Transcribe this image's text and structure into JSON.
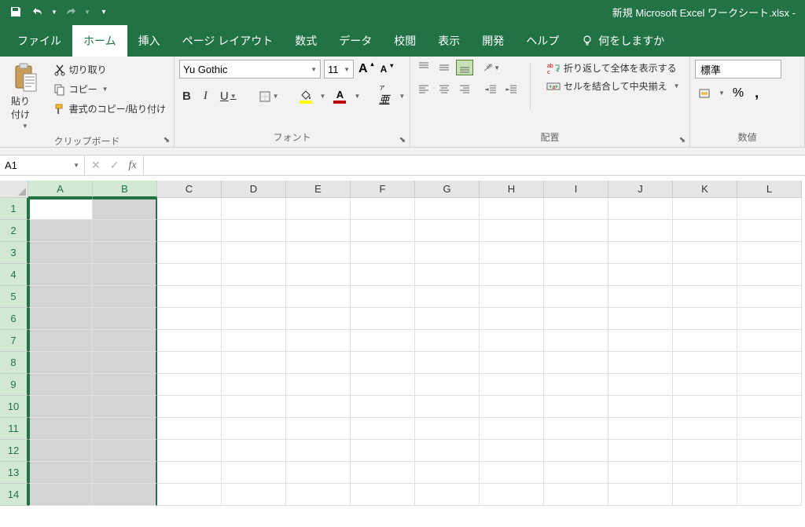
{
  "title": "新規 Microsoft Excel ワークシート.xlsx  -",
  "tabs": {
    "file": "ファイル",
    "home": "ホーム",
    "insert": "挿入",
    "page_layout": "ページ レイアウト",
    "formulas": "数式",
    "data": "データ",
    "review": "校閲",
    "view": "表示",
    "developer": "開発",
    "help": "ヘルプ",
    "tell_me": "何をしますか"
  },
  "clipboard": {
    "paste": "貼り付け",
    "cut": "切り取り",
    "copy": "コピー",
    "format_painter": "書式のコピー/貼り付け",
    "group": "クリップボード"
  },
  "font": {
    "name": "Yu Gothic",
    "size": "11",
    "group": "フォント"
  },
  "alignment": {
    "wrap": "折り返して全体を表示する",
    "merge": "セルを結合して中央揃え",
    "group": "配置"
  },
  "number": {
    "format": "標準",
    "percent": "%",
    "comma": ",",
    "group": "数値"
  },
  "namebox": "A1",
  "columns": [
    "A",
    "B",
    "C",
    "D",
    "E",
    "F",
    "G",
    "H",
    "I",
    "J",
    "K",
    "L"
  ],
  "rows": [
    "1",
    "2",
    "3",
    "4",
    "5",
    "6",
    "7",
    "8",
    "9",
    "10",
    "11",
    "12",
    "13",
    "14"
  ],
  "selected_cols": [
    "A",
    "B"
  ],
  "active_cell": "A1"
}
